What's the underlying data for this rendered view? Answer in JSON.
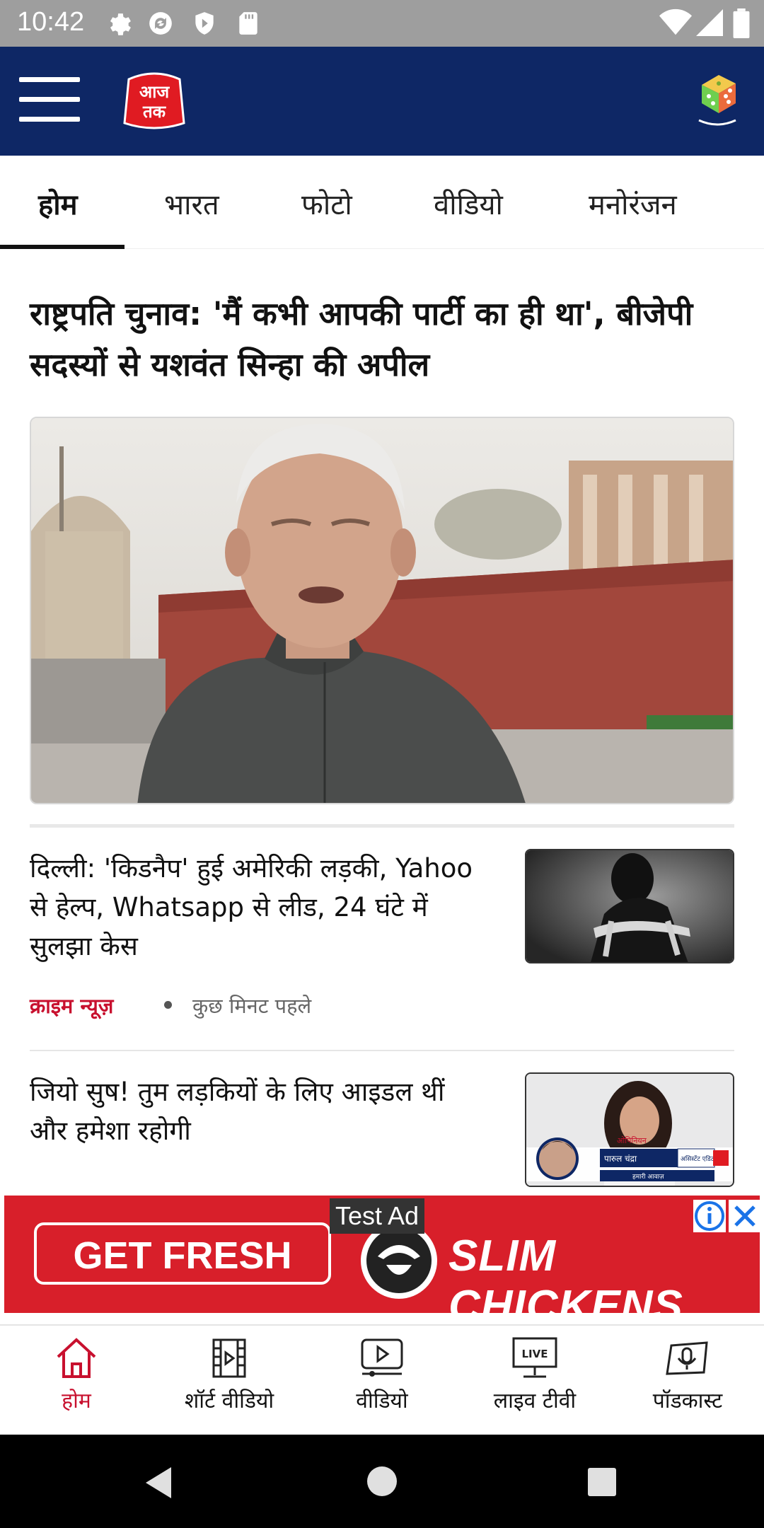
{
  "status_bar": {
    "time": "10:42"
  },
  "header": {
    "logo_text": "आज तक",
    "icons": [
      "menu-icon",
      "dice-game-icon"
    ]
  },
  "tabs": [
    {
      "label": "होम",
      "active": true
    },
    {
      "label": "भारत",
      "active": false
    },
    {
      "label": "फोटो",
      "active": false
    },
    {
      "label": "वीडियो",
      "active": false
    },
    {
      "label": "मनोरंजन",
      "active": false
    }
  ],
  "lead_story": {
    "title": "राष्ट्रपति चुनाव: 'मैं कभी आपकी पार्टी का ही था', बीजेपी सदस्यों से यशवंत सिन्हा की अपील"
  },
  "stories": [
    {
      "title": "दिल्ली: 'किडनैप' हुई अमेरिकी लड़की, Yahoo से हेल्प, Whatsapp से लीड, 24 घंटे में सुलझा केस",
      "category": "क्राइम न्यूज़",
      "time": "कुछ मिनट पहले"
    },
    {
      "title": "जियो सुष! तुम लड़कियों के लिए आइडल थीं और हमेशा रहोगी",
      "thumb_caption_name": "पारुल चंद्रा",
      "thumb_caption_role": "असिस्टेंट एडिटर",
      "thumb_caption_top": "ओपिनियन",
      "thumb_caption_bottom": "हमारी आवाज़"
    }
  ],
  "ad": {
    "label": "Test Ad",
    "cta": "GET FRESH",
    "brand": "SLIM CHICKENS"
  },
  "bottom_nav": [
    {
      "label": "होम",
      "icon": "home-icon",
      "active": true
    },
    {
      "label": "शॉर्ट वीडियो",
      "icon": "short-video-icon",
      "active": false
    },
    {
      "label": "वीडियो",
      "icon": "video-icon",
      "active": false
    },
    {
      "label": "लाइव टीवी",
      "icon": "live-tv-icon",
      "active": false,
      "badge": "LIVE"
    },
    {
      "label": "पॉडकास्ट",
      "icon": "podcast-icon",
      "active": false
    }
  ],
  "colors": {
    "header_bg": "#0e2765",
    "accent_red": "#c8102e",
    "ad_red": "#d81f2a"
  }
}
